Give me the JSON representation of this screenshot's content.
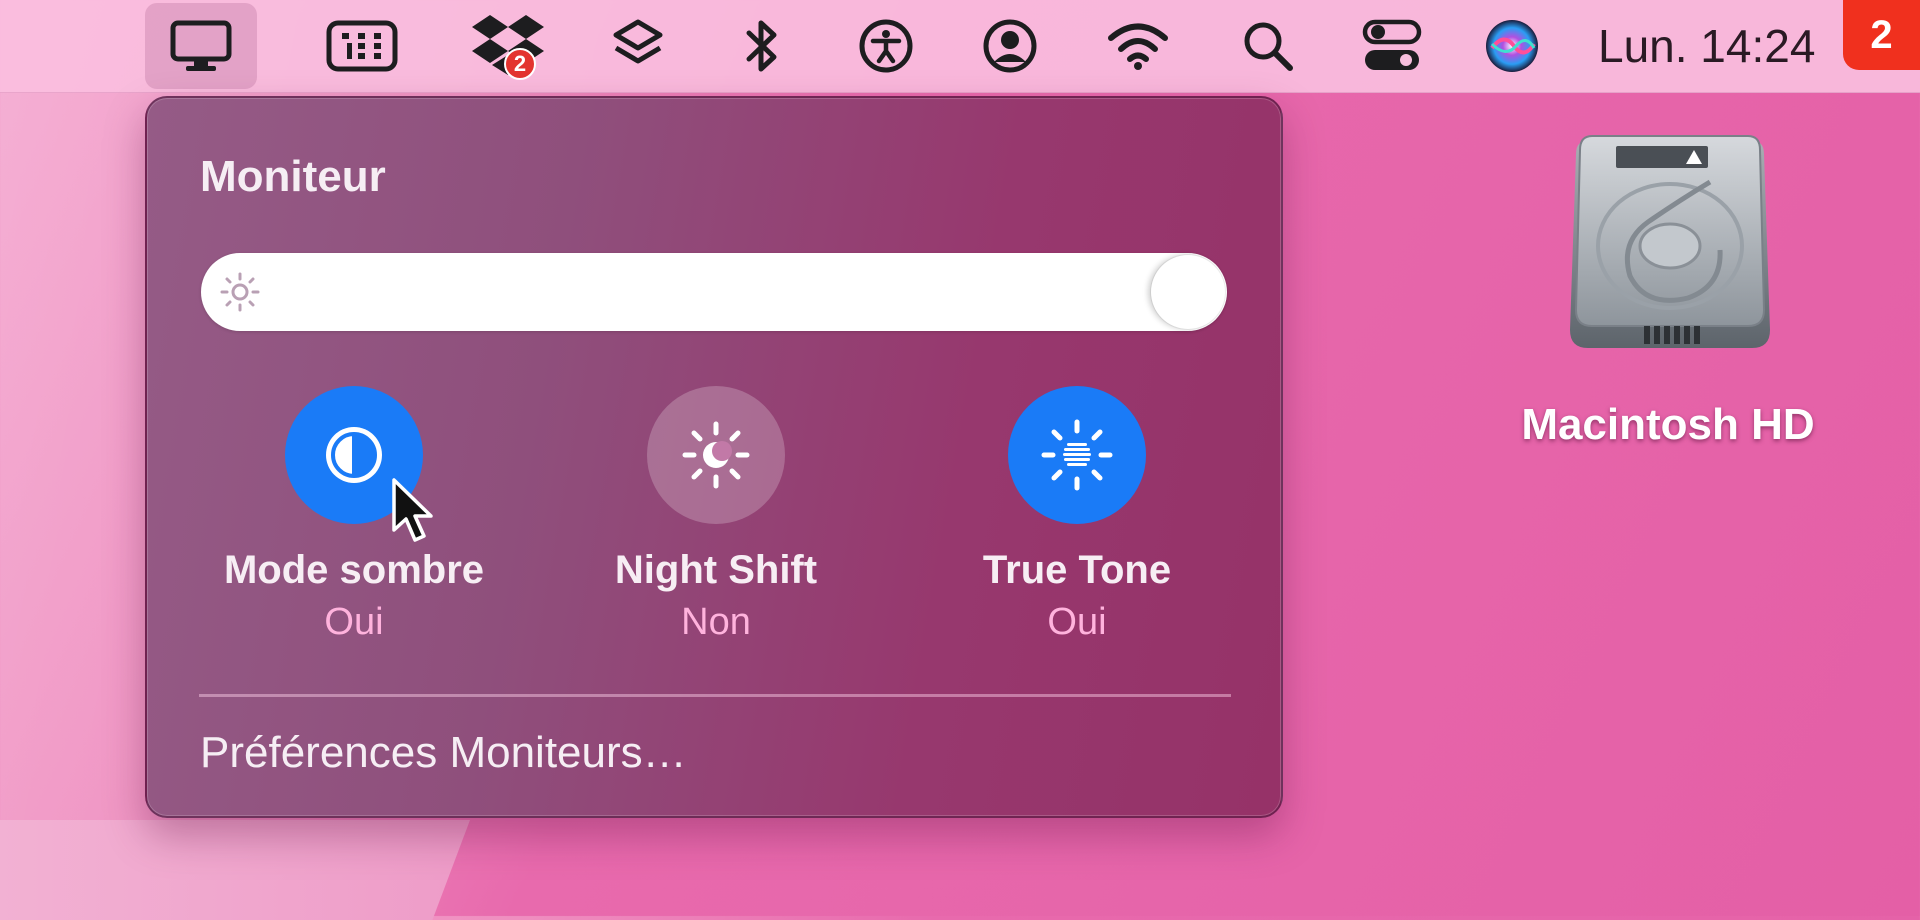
{
  "menubar": {
    "items": [
      {
        "name": "display-menu",
        "icon": "display-icon",
        "active": true
      },
      {
        "name": "keypad",
        "icon": "keypad-icon"
      },
      {
        "name": "dropbox",
        "icon": "dropbox-icon",
        "badge": "2"
      },
      {
        "name": "shortcuts",
        "icon": "shortcuts-icon"
      },
      {
        "name": "bluetooth",
        "icon": "bluetooth-icon"
      },
      {
        "name": "accessibility",
        "icon": "accessibility-icon"
      },
      {
        "name": "user",
        "icon": "user-icon"
      },
      {
        "name": "wifi",
        "icon": "wifi-icon"
      },
      {
        "name": "spotlight",
        "icon": "search-icon"
      },
      {
        "name": "control-center",
        "icon": "control-center-icon"
      },
      {
        "name": "siri",
        "icon": "siri-icon"
      }
    ],
    "clock": "Lun. 14:24",
    "step_badge": "2"
  },
  "panel": {
    "title": "Moniteur",
    "brightness": 1.0,
    "toggles": [
      {
        "label": "Mode sombre",
        "state": "Oui",
        "on": true,
        "icon": "dark-mode-icon"
      },
      {
        "label": "Night Shift",
        "state": "Non",
        "on": false,
        "icon": "night-shift-icon"
      },
      {
        "label": "True Tone",
        "state": "Oui",
        "on": true,
        "icon": "true-tone-icon"
      }
    ],
    "prefs_link": "Préférences Moniteurs…"
  },
  "desktop": {
    "disk_label": "Macintosh HD"
  },
  "colors": {
    "accent": "#1a7bf7",
    "state_text": "#ffb3dd",
    "badge": "#f0301e"
  }
}
